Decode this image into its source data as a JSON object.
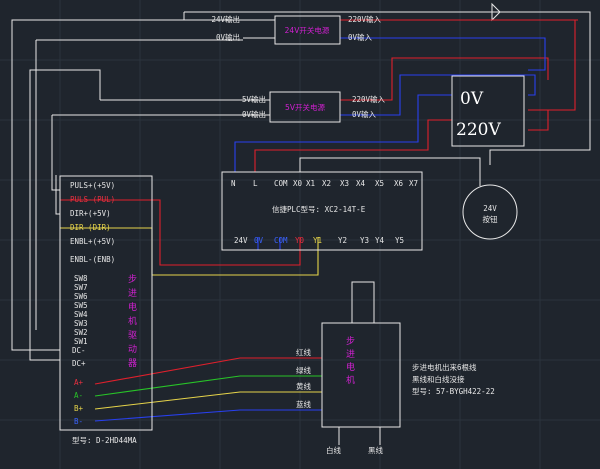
{
  "psu24": {
    "title": "24V开关电源",
    "out_pos": "24V输出",
    "out_neg": "0V输出",
    "in_l": "220V输入",
    "in_n": "0V输入"
  },
  "psu5": {
    "title": "5V开关电源",
    "out_pos": "5V输出",
    "out_neg": "0V输出",
    "in_l": "220V输入",
    "in_n": "0V输入"
  },
  "mains": {
    "line_0v": "0V",
    "line_220v": "220V"
  },
  "plc": {
    "top_terms": [
      "N",
      "L",
      "COM",
      "X0",
      "X1",
      "X2",
      "X3",
      "X4",
      "X5",
      "X6",
      "X7"
    ],
    "model": "信捷PLC型号: XC2-14T-E",
    "bot_terms": [
      "24V",
      "0V",
      "COM",
      "Y0",
      "Y1",
      "Y2",
      "Y3",
      "Y4",
      "Y5"
    ]
  },
  "button": {
    "line1": "24V",
    "line2": "按钮"
  },
  "driver": {
    "pins": [
      "PULS+(+5V)",
      "PULS-(PUL)",
      "DIR+(+5V)",
      "DIR-(DIR)",
      "ENBL+(+5V)",
      "ENBL-(ENB)"
    ],
    "switches": [
      "SW8",
      "SW7",
      "SW6",
      "SW5",
      "SW4",
      "SW3",
      "SW2",
      "SW1"
    ],
    "dc": [
      "DC-",
      "DC+"
    ],
    "motor_pins": [
      "A+",
      "A-",
      "B+",
      "B-"
    ],
    "title": "步进电机驱动器",
    "model": "型号: D-2HD44MA"
  },
  "motor": {
    "title": "步进电机",
    "wires": [
      "红线",
      "绿线",
      "黄线",
      "蓝线"
    ],
    "bottom": [
      "白线",
      "黑线"
    ],
    "note": [
      "步进电机出来6根线",
      "黑线和白线没接",
      "型号: 57-BYGH422-22"
    ]
  },
  "colors": {
    "red": "#e0202c",
    "blue": "#2840f0",
    "yellow": "#e6d44a",
    "green": "#28c428",
    "magenta": "#d020d0",
    "white": "#e8e8e8"
  }
}
